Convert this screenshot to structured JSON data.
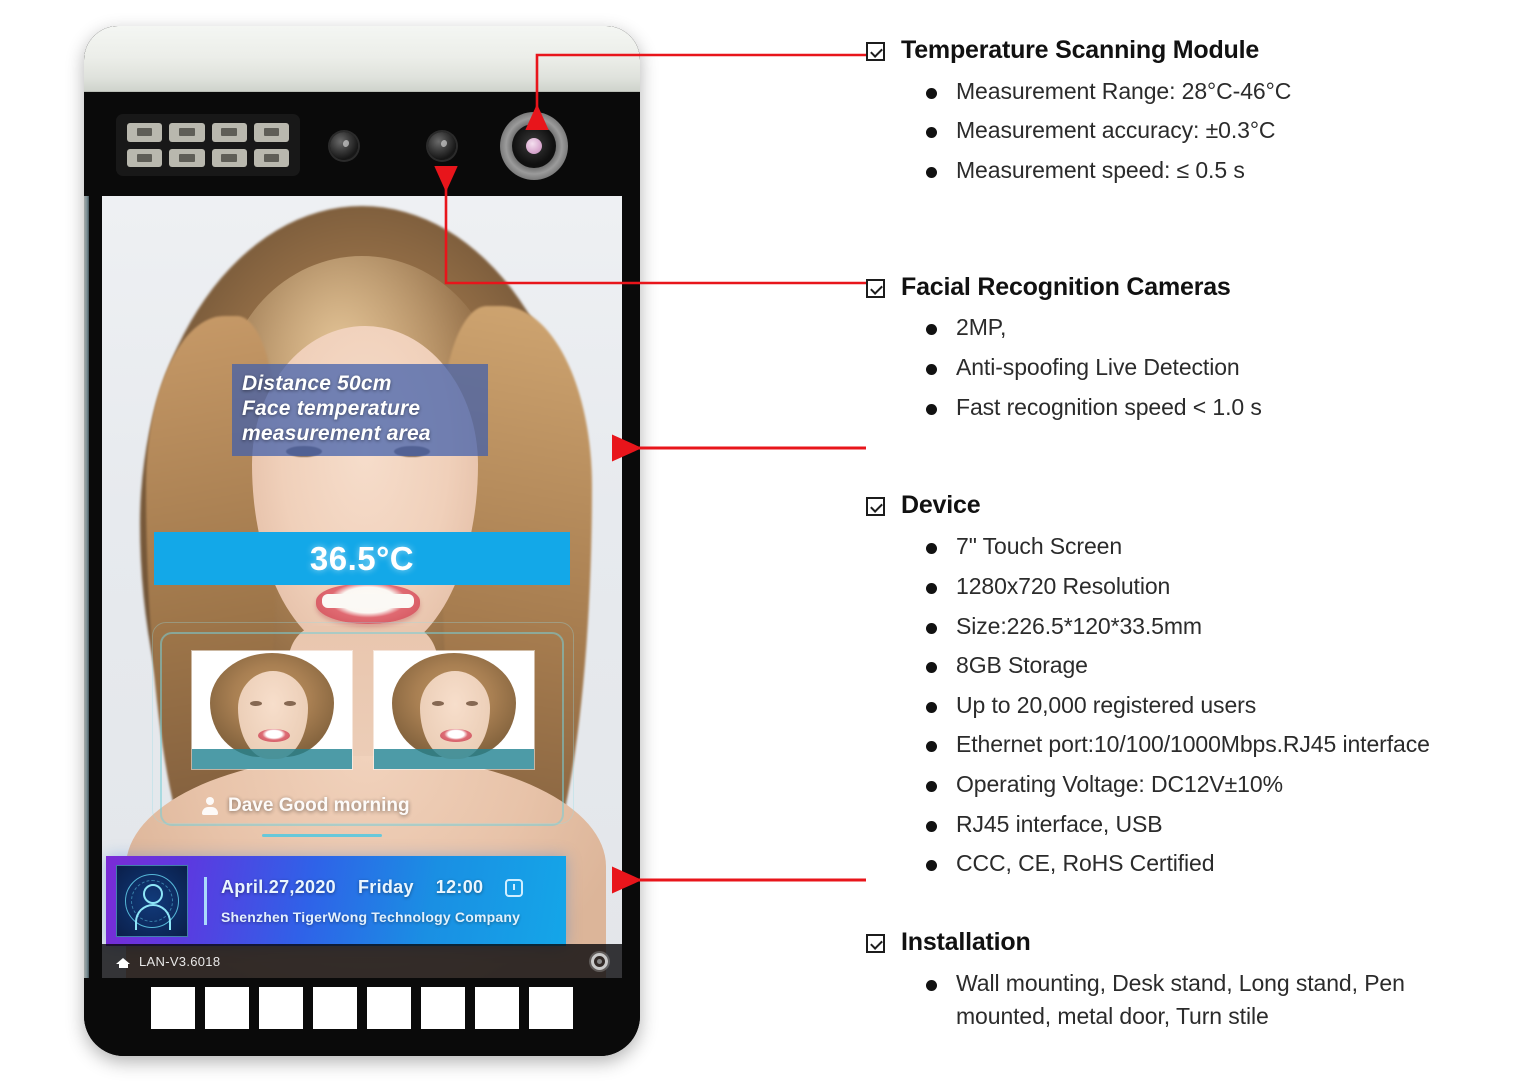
{
  "device": {
    "name": "face-recognition-temperature-terminal",
    "screen": {
      "distance_overlay": "Distance 50cm\nFace temperature\nmeasurement area",
      "distance_line1": "Distance 50cm",
      "distance_line2": "Face temperature",
      "distance_line3": "measurement area",
      "temperature_reading": "36.5°C",
      "greeting": "Dave  Good morning",
      "widget": {
        "date": "April.27,2020",
        "weekday": "Friday",
        "time": "12:00",
        "company": "Shenzhen TigerWong Technology Company",
        "alarm_icon": "alarm-clock-icon",
        "face_icon": "face-scan-icon"
      },
      "statusbar": {
        "home_icon": "home-icon",
        "firmware": "LAN-V3.6018",
        "gear_icon": "gear-icon"
      }
    },
    "hardware": {
      "led_array_icon": "ir-led-array",
      "camera_left_icon": "camera-lens-icon",
      "camera_right_icon": "camera-lens-icon",
      "temperature_sensor_icon": "temperature-sensor-icon",
      "fill_light_count": 8
    }
  },
  "colors": {
    "accent_red": "#e8151b",
    "temp_bar_blue": "#13a8e8",
    "overlay_blue": "rgba(63,94,172,0.72)",
    "widget_gradient_start": "#7b2bd6",
    "widget_gradient_end": "#14a6e8",
    "text_dark": "#111111"
  },
  "specs": [
    {
      "id": "temperature-scanning-module",
      "title": "Temperature Scanning Module",
      "items": [
        "Measurement Range: 28°C-46°C",
        "Measurement accuracy: ±0.3°C",
        "Measurement speed: ≤ 0.5 s"
      ]
    },
    {
      "id": "facial-recognition-cameras",
      "title": "Facial Recognition Cameras",
      "items": [
        "2MP,",
        "Anti-spoofing Live Detection",
        "Fast recognition speed < 1.0 s"
      ]
    },
    {
      "id": "device",
      "title": "Device",
      "items": [
        "7\" Touch Screen",
        "1280x720 Resolution",
        "Size:226.5*120*33.5mm",
        "8GB Storage",
        "Up to 20,000 registered users",
        "Ethernet port:10/100/1000Mbps.RJ45 interface",
        "Operating Voltage: DC12V±10%",
        "RJ45 interface, USB",
        "CCC, CE, RoHS Certified"
      ]
    },
    {
      "id": "installation",
      "title": "Installation",
      "items": [
        "Wall mounting, Desk stand, Long stand, Pen mounted, metal door, Turn stile"
      ]
    }
  ]
}
